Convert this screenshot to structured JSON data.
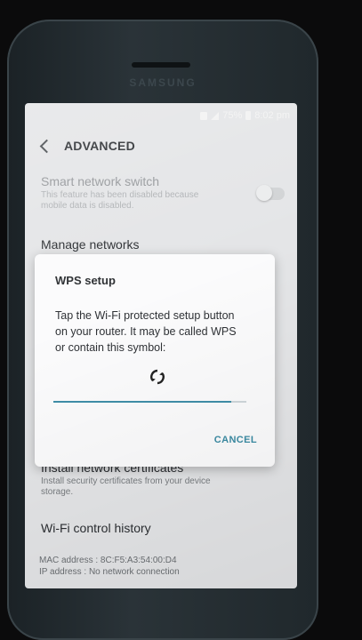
{
  "device": {
    "brand": "SAMSUNG"
  },
  "status_bar": {
    "battery": "75%",
    "time": "8:02 pm"
  },
  "header": {
    "title": "ADVANCED"
  },
  "settings": {
    "smart_switch": {
      "title": "Smart network switch",
      "subtitle_line1": "This feature has been disabled because",
      "subtitle_line2": "mobile data is disabled.",
      "enabled": false
    },
    "manage_networks": {
      "title": "Manage networks"
    },
    "install_certs": {
      "title": "Install network certificates",
      "subtitle_line1": "Install security certificates from your device",
      "subtitle_line2": "storage."
    },
    "wifi_history": {
      "title": "Wi-Fi control history"
    },
    "mac_address": "MAC address : 8C:F5:A3:54:00:D4",
    "ip_address": "IP address : No network connection"
  },
  "dialog": {
    "title": "WPS setup",
    "body_line1": "Tap the Wi-Fi protected setup button",
    "body_line2": "on your router. It may be called WPS",
    "body_line3": "or contain this symbol:",
    "icon": "wps-icon",
    "progress": 0.92,
    "cancel_label": "CANCEL"
  },
  "colors": {
    "accent": "#3b8ba3",
    "screen_bg": "#ecedef",
    "dialog_bg": "#fbfbfc"
  }
}
